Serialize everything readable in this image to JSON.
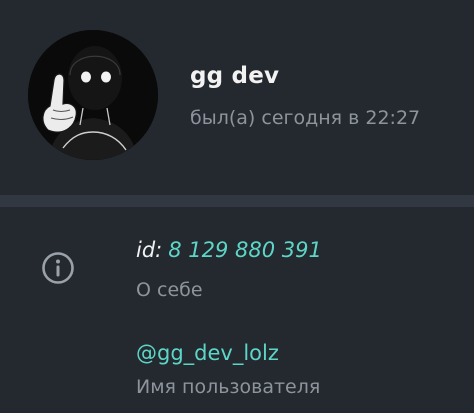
{
  "profile": {
    "name": "gg dev",
    "status": "был(а) сегодня в 22:27"
  },
  "info": {
    "id_prefix": "id:",
    "id_value": "8 129 880 391",
    "about_label": "О себе",
    "username": "@gg_dev_lolz",
    "username_label": "Имя пользователя"
  },
  "icons": {
    "info": "info-circle-icon"
  },
  "colors": {
    "background": "#24292f",
    "divider": "#313841",
    "accent": "#5dd6c8",
    "secondary_text": "#8d949c",
    "primary_text": "#f2f2f2"
  }
}
